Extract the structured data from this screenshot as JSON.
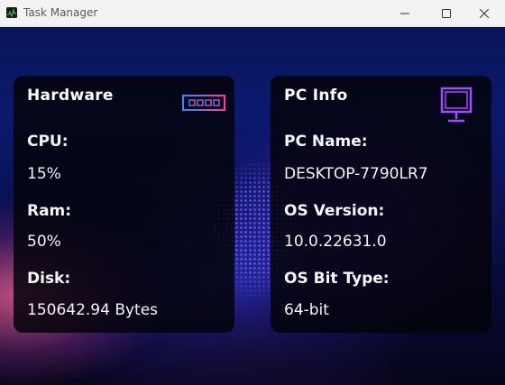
{
  "window": {
    "title": "Task Manager"
  },
  "hardware": {
    "title": "Hardware",
    "icon": "ram-chip-icon",
    "cpu_label": "CPU:",
    "cpu_value": "15%",
    "ram_label": "Ram:",
    "ram_value": "50%",
    "disk_label": "Disk:",
    "disk_value": "150642.94 Bytes"
  },
  "pc_info": {
    "title": "PC Info",
    "icon": "monitor-icon",
    "name_label": "PC Name:",
    "name_value": "DESKTOP-7790LR7",
    "os_version_label": "OS Version:",
    "os_version_value": "10.0.22631.0",
    "os_bit_label": "OS Bit Type:",
    "os_bit_value": "64-bit"
  },
  "colors": {
    "card_bg": "#03030c",
    "ram_icon_start": "#2e8bff",
    "ram_icon_end": "#ff3aa0",
    "monitor_icon": "#a24bff",
    "background": "#0b1a6e"
  }
}
